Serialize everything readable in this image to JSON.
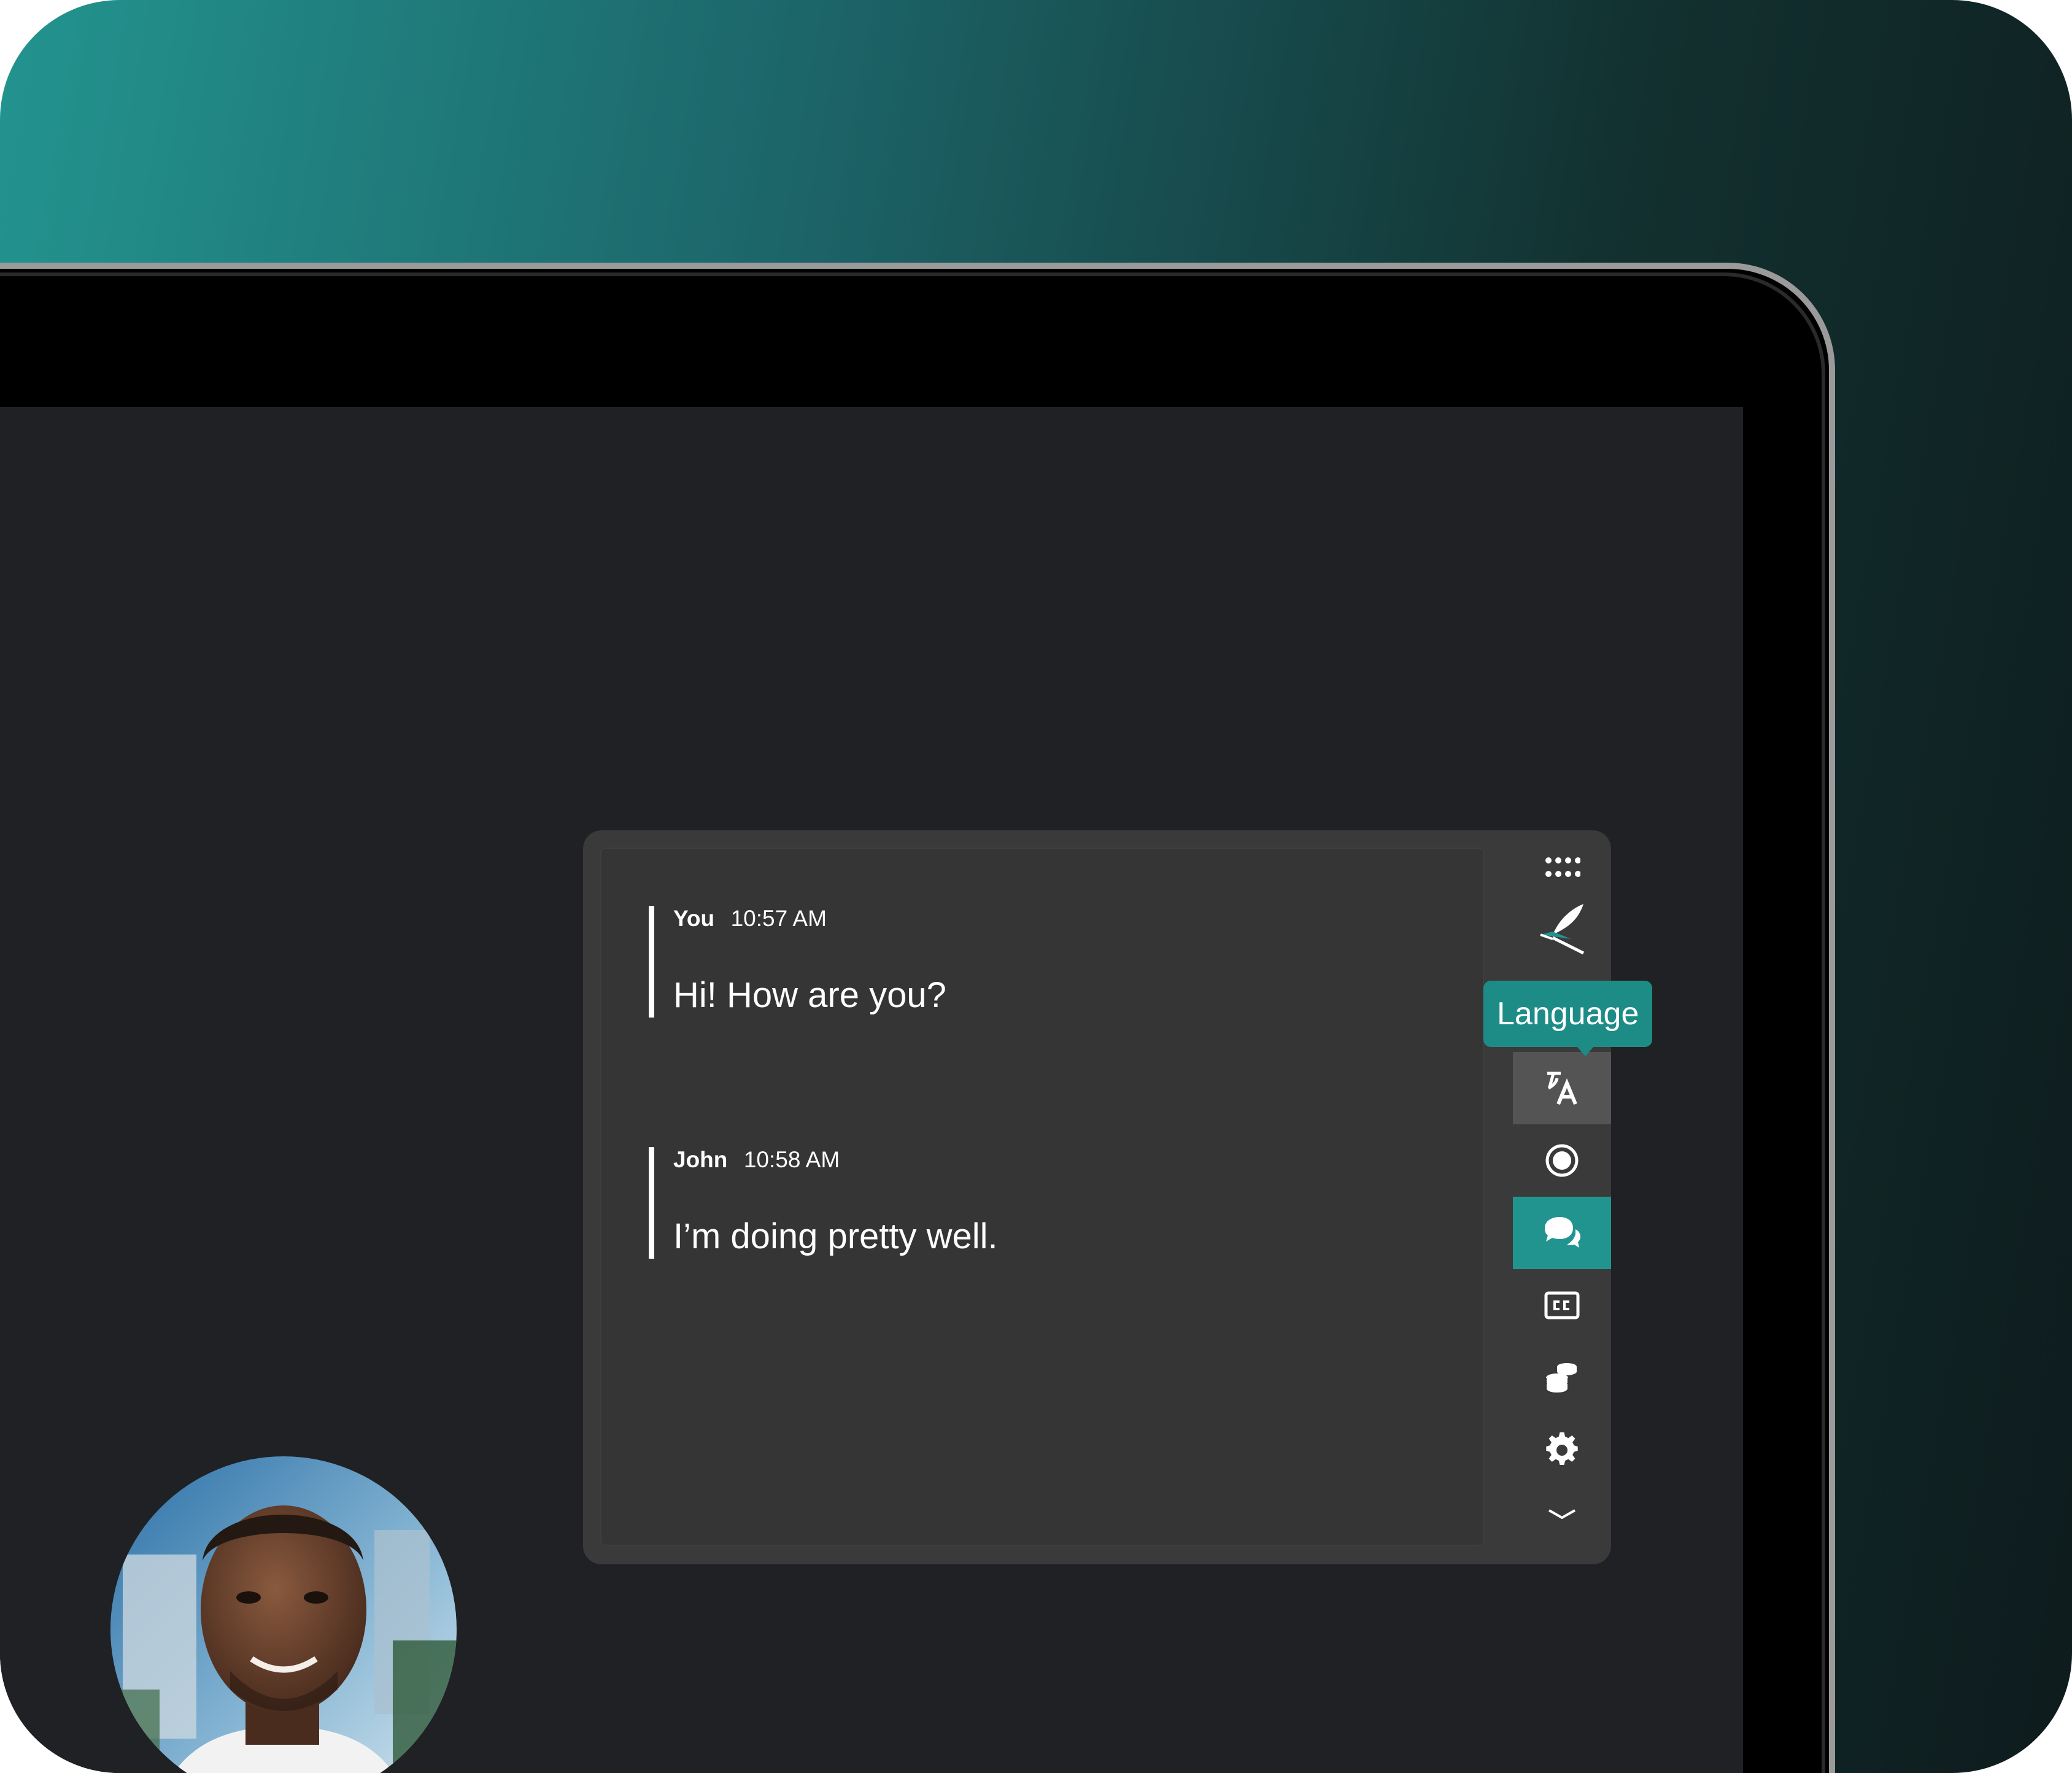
{
  "messages": [
    {
      "sender": "You",
      "time": "10:57 AM",
      "text": "Hi! How are you?"
    },
    {
      "sender": "John",
      "time": "10:58 AM",
      "text": "I’m doing pretty well."
    }
  ],
  "tooltip": {
    "label": "Language"
  },
  "toolbar": {
    "icons": [
      "drag-handle-icon",
      "brand-logo-icon",
      "translate-icon",
      "record-icon",
      "chat-icon",
      "closed-captions-icon",
      "coins-icon",
      "gear-icon",
      "chevron-down-icon"
    ],
    "hovered": "translate-icon",
    "active": "chat-icon"
  },
  "colors": {
    "accent": "#229490",
    "tooltip": "#1e8c86",
    "screen": "#202124",
    "panel": "#3a3a3a"
  }
}
